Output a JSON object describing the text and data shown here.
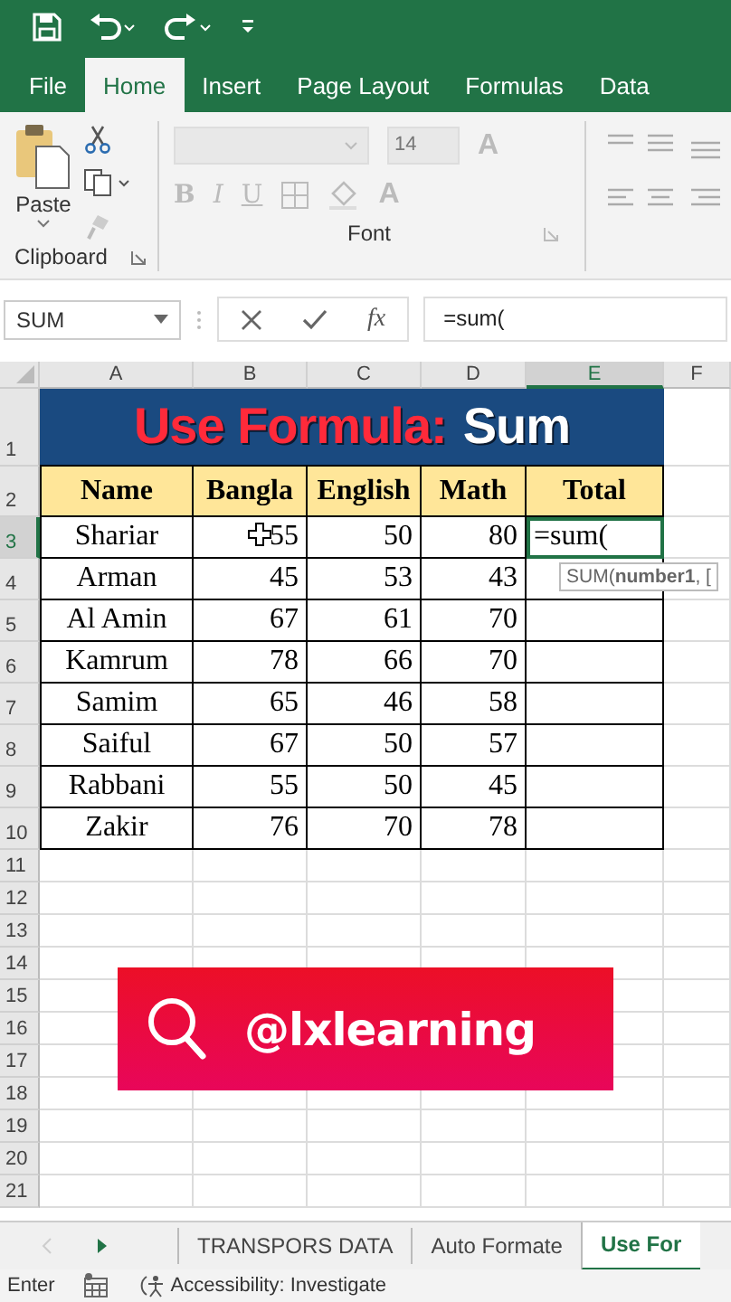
{
  "tabs": [
    {
      "label": "File",
      "selected": false
    },
    {
      "label": "Home",
      "selected": true
    },
    {
      "label": "Insert",
      "selected": false
    },
    {
      "label": "Page Layout",
      "selected": false
    },
    {
      "label": "Formulas",
      "selected": false
    },
    {
      "label": "Data",
      "selected": false
    }
  ],
  "ribbon": {
    "clipboard": {
      "paste_label": "Paste",
      "group_label": "Clipboard"
    },
    "font": {
      "size": "14",
      "format_buttons": [
        "B",
        "I",
        "U"
      ],
      "color_letter": "A",
      "grow_letter": "A",
      "group_label": "Font"
    }
  },
  "formula_bar": {
    "name_box": "SUM",
    "fx": "fx",
    "value": "=sum("
  },
  "sheet": {
    "columns": [
      {
        "label": "A",
        "selected": false
      },
      {
        "label": "B",
        "selected": false
      },
      {
        "label": "C",
        "selected": false
      },
      {
        "label": "D",
        "selected": false
      },
      {
        "label": "E",
        "selected": true
      },
      {
        "label": "F",
        "selected": false
      }
    ],
    "title_row": "1",
    "title_parts": [
      {
        "text": "Use Formula:",
        "color": "#ff2a3a"
      },
      {
        "text": "Sum",
        "color": "#ffffff"
      }
    ],
    "header_row": "2",
    "headers": [
      "Name",
      "Bangla",
      "English",
      "Math",
      "Total"
    ],
    "rows": [
      {
        "row": "3",
        "selected": true,
        "cells": [
          "Shariar",
          "55",
          "50",
          "80",
          "=sum("
        ]
      },
      {
        "row": "4",
        "selected": false,
        "cells": [
          "Arman",
          "45",
          "53",
          "43",
          ""
        ]
      },
      {
        "row": "5",
        "selected": false,
        "cells": [
          "Al Amin",
          "67",
          "61",
          "70",
          ""
        ]
      },
      {
        "row": "6",
        "selected": false,
        "cells": [
          "Kamrum",
          "78",
          "66",
          "70",
          ""
        ]
      },
      {
        "row": "7",
        "selected": false,
        "cells": [
          "Samim",
          "65",
          "46",
          "58",
          ""
        ]
      },
      {
        "row": "8",
        "selected": false,
        "cells": [
          "Saiful",
          "67",
          "50",
          "57",
          ""
        ]
      },
      {
        "row": "9",
        "selected": false,
        "cells": [
          "Rabbani",
          "55",
          "50",
          "45",
          ""
        ]
      },
      {
        "row": "10",
        "selected": false,
        "cells": [
          "Zakir",
          "76",
          "70",
          "78",
          ""
        ]
      }
    ],
    "empty_rows": [
      "11",
      "12",
      "13",
      "14",
      "15",
      "16",
      "17",
      "18",
      "19",
      "20",
      "21"
    ],
    "tooltip": "SUM(**number1**, [",
    "banner": "@lxlearning"
  },
  "sheet_tabs": [
    {
      "label": "TRANSPORS DATA",
      "selected": false
    },
    {
      "label": "Auto Formate",
      "selected": false
    },
    {
      "label": "Use For",
      "selected": true
    }
  ],
  "status_bar": {
    "mode": "Enter",
    "accessibility": "Accessibility: Investigate"
  }
}
